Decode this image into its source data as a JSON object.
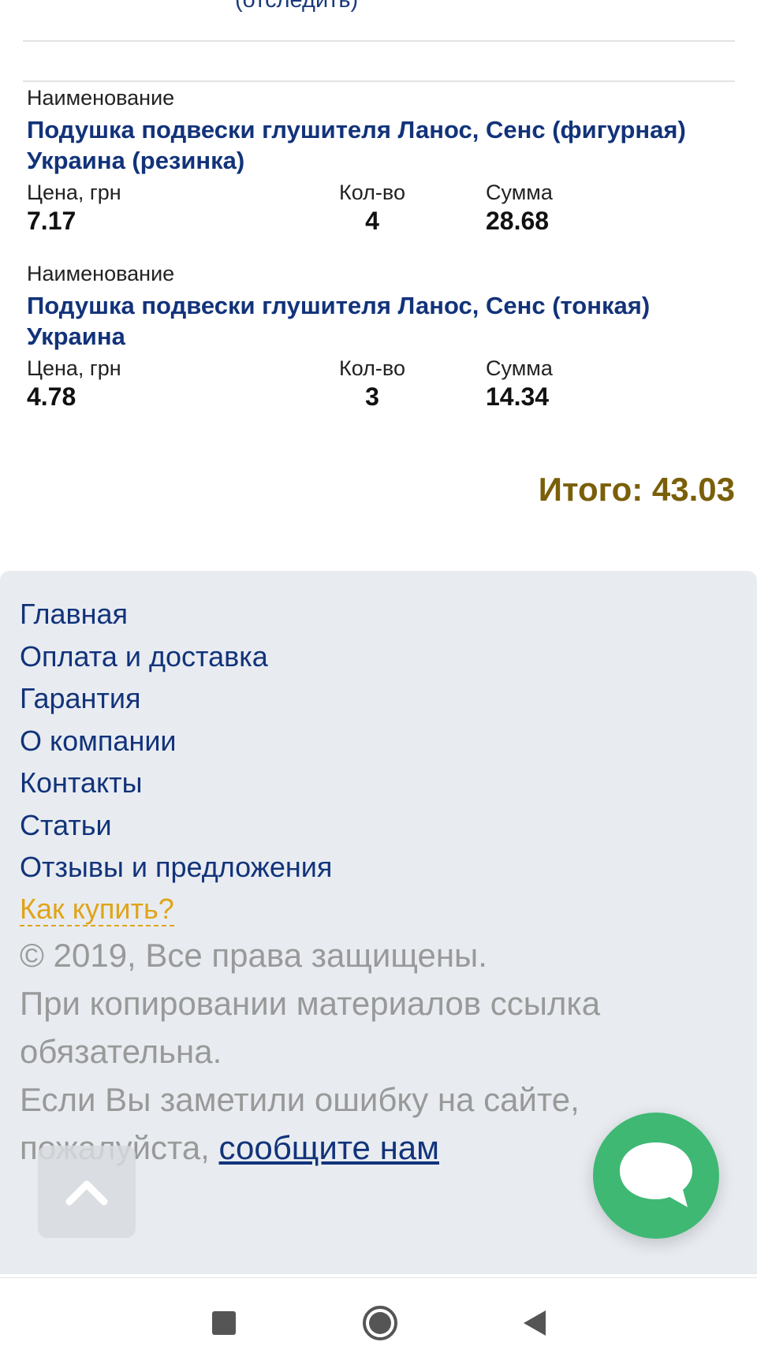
{
  "order": {
    "track_link": "(отследить)",
    "items": [
      {
        "name_label": "Наименование",
        "name": "Подушка подвески глушителя Ланос, Сенс (фигурная) Украина (резинка)",
        "price_label": "Цена, грн",
        "price": "7.17",
        "qty_label": "Кол-во",
        "qty": "4",
        "sum_label": "Сумма",
        "sum": "28.68"
      },
      {
        "name_label": "Наименование",
        "name": "Подушка подвески глушителя Ланос, Сенс (тонкая) Украина",
        "price_label": "Цена, грн",
        "price": "4.78",
        "qty_label": "Кол-во",
        "qty": "3",
        "sum_label": "Сумма",
        "sum": "14.34"
      }
    ],
    "total": "Итого: 43.03"
  },
  "footer": {
    "nav": [
      "Главная",
      "Оплата и доставка",
      "Гарантия",
      "О компании",
      "Контакты",
      "Статьи",
      "Отзывы и предложения"
    ],
    "how_to_buy": "Как купить?",
    "copyright": "© 2019, Все права защищены.",
    "copy_notice": "При копировании материалов ссылка обязательна.",
    "error_notice": "Если Вы заметили ошибку на сайте, пожалуйста,",
    "report_link": "сообщите нам"
  },
  "colors": {
    "link": "#12337a",
    "total": "#7a5f0a",
    "how_to_buy": "#e0a418",
    "chat": "#3fb874",
    "footer_bg": "#e8ecf1"
  },
  "icons": {
    "scroll_top": "chevron-up-icon",
    "chat": "chat-bubble-icon",
    "recents": "square-icon",
    "home": "circle-icon",
    "back": "triangle-left-icon"
  }
}
